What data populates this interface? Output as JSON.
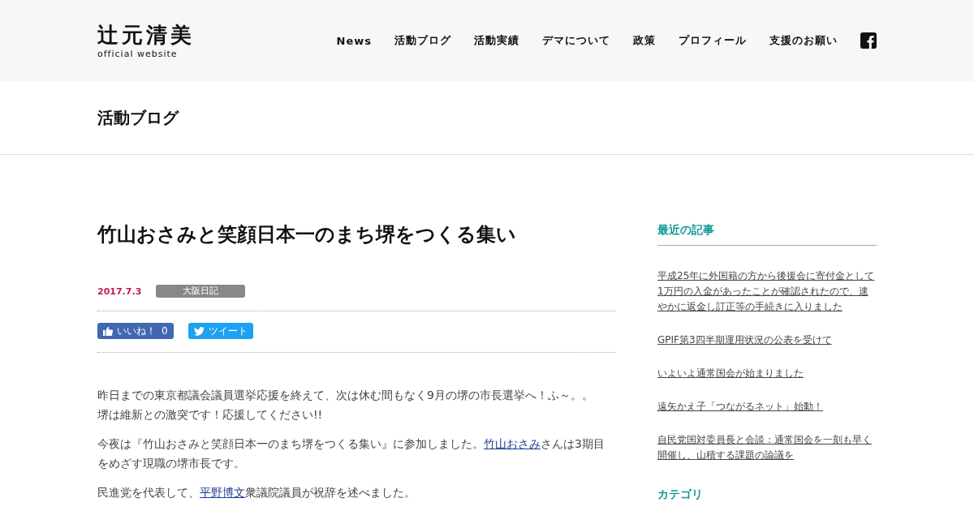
{
  "header": {
    "logo": {
      "name": "辻元清美",
      "subtitle": "official website"
    },
    "nav": [
      {
        "label": "News"
      },
      {
        "label": "活動ブログ"
      },
      {
        "label": "活動実績"
      },
      {
        "label": "デマについて"
      },
      {
        "label": "政策"
      },
      {
        "label": "プロフィール"
      },
      {
        "label": "支援のお願い"
      }
    ]
  },
  "page_title": "活動ブログ",
  "article": {
    "title": "竹山おさみと笑顔日本一のまち堺をつくる集い",
    "date": "2017.7.3",
    "category": "大阪日記",
    "like_button": {
      "label": "いいね！",
      "count": "0"
    },
    "tweet_button": {
      "label": "ツイート"
    },
    "paragraphs": [
      {
        "lines": [
          [
            {
              "kind": "text",
              "text": "昨日までの東京都議会議員選挙応援を終えて、次は休む間もなく9月の堺の市長選挙へ！ふ～。。"
            }
          ],
          [
            {
              "kind": "text",
              "text": "堺は維新との激突です！応援してください!!"
            }
          ]
        ]
      },
      {
        "lines": [
          [
            {
              "kind": "text",
              "text": "今夜は『竹山おさみと笑顔日本一のまち堺をつくる集い』に参加しました。"
            },
            {
              "kind": "link",
              "text": "竹山おさみ"
            },
            {
              "kind": "text",
              "text": "さんは3期目をめざす現職の堺市長です。"
            }
          ]
        ]
      },
      {
        "lines": [
          [
            {
              "kind": "text",
              "text": "民進党を代表して、"
            },
            {
              "kind": "link",
              "text": "平野博文"
            },
            {
              "kind": "text",
              "text": "衆議院議員が祝辞を述べました。"
            }
          ]
        ]
      }
    ]
  },
  "sidebar": {
    "recent_heading": "最近の記事",
    "recent_posts": [
      "平成25年に外国籍の方から後援会に寄付金として1万円の入金があったことが確認されたので、速やかに返金し訂正等の手続きに入りました",
      "GPIF第3四半期運用状況の公表を受けて",
      "いよいよ通常国会が始まりました",
      "遠矢かえ子「つながるネット」始動！",
      "自民党国対委員長と会談：通常国会を一刻も早く開催し、山積する課題の論議を"
    ],
    "category_heading": "カテゴリ"
  }
}
